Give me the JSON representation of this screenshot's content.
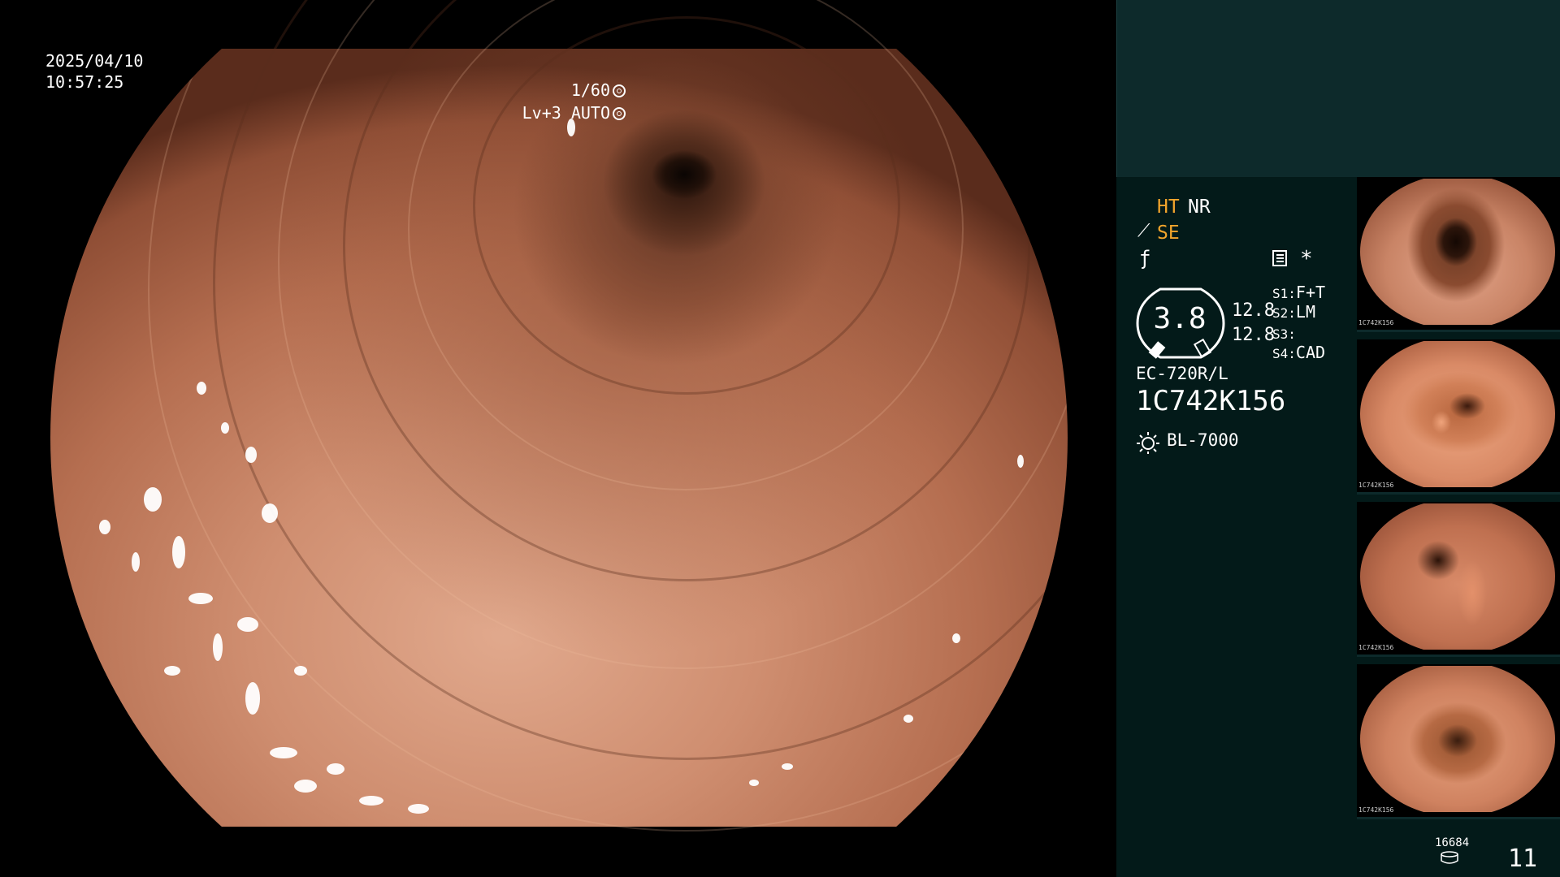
{
  "overlay": {
    "date": "2025/04/10",
    "time": "10:57:25",
    "shutter": "1/60",
    "level": "Lv+3 AUTO"
  },
  "panel": {
    "ht": "HT",
    "nr": "NR",
    "se": "SE",
    "gauge_value": "3.8",
    "value_1": "12.8",
    "value_2": "12.8",
    "s1_key": "S1:",
    "s1_value": "F+T",
    "s2_key": "S2:",
    "s2_value": "LM",
    "s3_key": "S3:",
    "s3_value": "",
    "s4_key": "S4:",
    "s4_value": "CAD",
    "scope_model": "EC-720R/L",
    "scope_serial": "1C742K156",
    "light_source": "BL-7000",
    "stored_count": "16684",
    "image_count": "11"
  },
  "thumbnails": [
    {
      "caption": "1C742K156"
    },
    {
      "caption": "1C742K156"
    },
    {
      "caption": "1C742K156"
    },
    {
      "caption": "1C742K156"
    }
  ],
  "colors": {
    "accent_orange": "#f3a52c",
    "panel_dark": "#031a19",
    "panel_top": "#0d2a2b"
  },
  "icons": [
    "aperture-icon",
    "auto-iris-icon",
    "se-mode-icon",
    "f-mode-icon",
    "list-icon",
    "star-icon",
    "gauge-icon",
    "light-source-icon",
    "database-icon"
  ]
}
